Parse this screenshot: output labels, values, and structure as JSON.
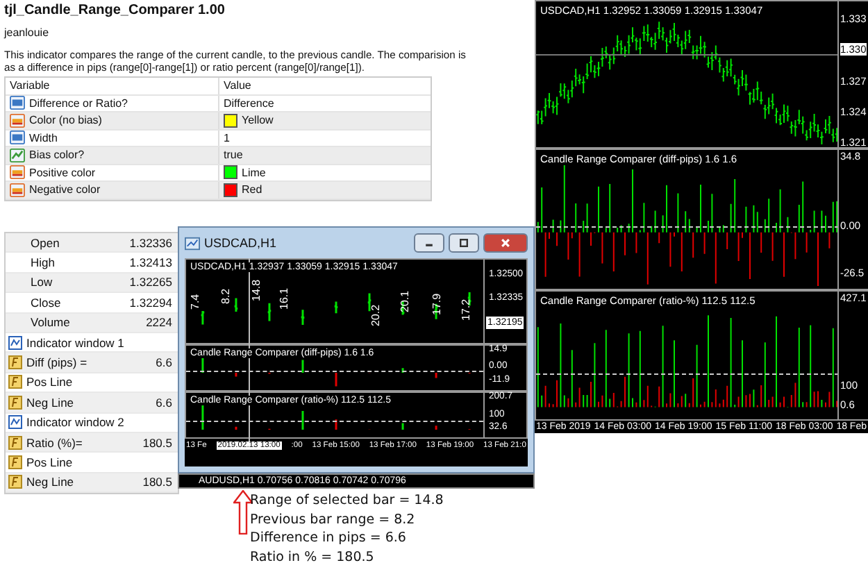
{
  "indicator": {
    "title": "tjl_Candle_Range_Comparer 1.00",
    "author": "jeanlouie",
    "description": "This indicator compares the range of the current candle, to the previous candle. The comparision is as a difference in pips (range[0]-range[1]) or ratio percent (range[0]/range[1])."
  },
  "inputs": {
    "columns": [
      "Variable",
      "Value"
    ],
    "rows": [
      {
        "kind": "number",
        "name": "Difference or Ratio?",
        "value": "Difference"
      },
      {
        "kind": "color",
        "name": "Color (no bias)",
        "value": "Yellow",
        "color": "#ffff00"
      },
      {
        "kind": "number",
        "name": "Width",
        "value": "1"
      },
      {
        "kind": "bool",
        "name": "Bias color?",
        "value": "true"
      },
      {
        "kind": "color",
        "name": "Positive color",
        "value": "Lime",
        "color": "#00ff00"
      },
      {
        "kind": "color",
        "name": "Negative color",
        "value": "Red",
        "color": "#ff0000"
      }
    ]
  },
  "main_chart": {
    "header": "USDCAD,H1  1.32952 1.33059 1.32915 1.33047",
    "price_labels": [
      {
        "text": "1.333",
        "kind": "tick"
      },
      {
        "text": "1.330",
        "kind": "current"
      },
      {
        "text": "1.327",
        "kind": "tick"
      },
      {
        "text": "1.324",
        "kind": "tick"
      },
      {
        "text": "1.321",
        "kind": "tick"
      }
    ],
    "panes": [
      {
        "kind": "diff",
        "title": "Candle Range Comparer (diff-pips) 1.6 1.6",
        "labels": [
          "34.8",
          "0.00",
          "-26.5"
        ]
      },
      {
        "kind": "ratio",
        "title": "Candle Range Comparer (ratio-%) 112.5 112.5",
        "labels": [
          "427.1",
          "100",
          "0.6"
        ]
      }
    ],
    "time_labels": [
      "13 Feb 2019",
      "14 Feb 03:00",
      "14 Feb 19:00",
      "15 Feb 11:00",
      "18 Feb 03:00",
      "18 Feb"
    ]
  },
  "data_window": {
    "rows": [
      {
        "kind": "value",
        "label": "Open",
        "value": "1.32336"
      },
      {
        "kind": "value",
        "label": "High",
        "value": "1.32413"
      },
      {
        "kind": "value",
        "label": "Low",
        "value": "1.32265"
      },
      {
        "kind": "value",
        "label": "Close",
        "value": "1.32294"
      },
      {
        "kind": "value",
        "label": "Volume",
        "value": "2224"
      },
      {
        "kind": "section",
        "label": "Indicator window 1"
      },
      {
        "kind": "buffer",
        "label": "Diff (pips) =",
        "value": "6.6"
      },
      {
        "kind": "buffer",
        "label": "Pos Line"
      },
      {
        "kind": "buffer",
        "label": "Neg Line",
        "value": "6.6"
      },
      {
        "kind": "section",
        "label": "Indicator window 2"
      },
      {
        "kind": "buffer",
        "label": "Ratio (%)=",
        "value": "180.5"
      },
      {
        "kind": "buffer",
        "label": "Pos Line"
      },
      {
        "kind": "buffer",
        "label": "Neg Line",
        "value": "180.5"
      }
    ]
  },
  "chart_window": {
    "title": "USDCAD,H1",
    "header": "USDCAD,H1  1.32937 1.33059 1.32915 1.33047",
    "bar_labels": [
      "7.4",
      "8.2",
      "14.8",
      "16.1",
      "20.2",
      "20.1",
      "17.9",
      "17.2"
    ],
    "price_labels": [
      {
        "text": "1.32500",
        "kind": "tick"
      },
      {
        "text": "1.32335",
        "kind": "tick"
      },
      {
        "text": "1.32195",
        "kind": "current"
      }
    ],
    "panes": [
      {
        "kind": "diff",
        "title": "Candle Range Comparer (diff-pips) 1.6 1.6",
        "labels": [
          "14.9",
          "0.00",
          "-11.9"
        ]
      },
      {
        "kind": "ratio",
        "title": "Candle Range Comparer (ratio-%) 112.5 112.5",
        "labels": [
          "200.7",
          "100",
          "32.6"
        ]
      }
    ],
    "time_labels": [
      "13 Fe",
      ":00",
      "13 Feb 15:00",
      "13 Feb 17:00",
      "13 Feb 19:00",
      "13 Feb 21:0"
    ],
    "crosshair_time": "2019.02.13 13:00"
  },
  "next_chart": {
    "header": "AUDUSD,H1  0.70756 0.70816 0.70742 0.70796"
  },
  "annotation": [
    "Range of selected bar = 14.8",
    "Previous bar range = 8.2",
    "Difference in pips = 6.6",
    "Ratio in % = 180.5"
  ]
}
